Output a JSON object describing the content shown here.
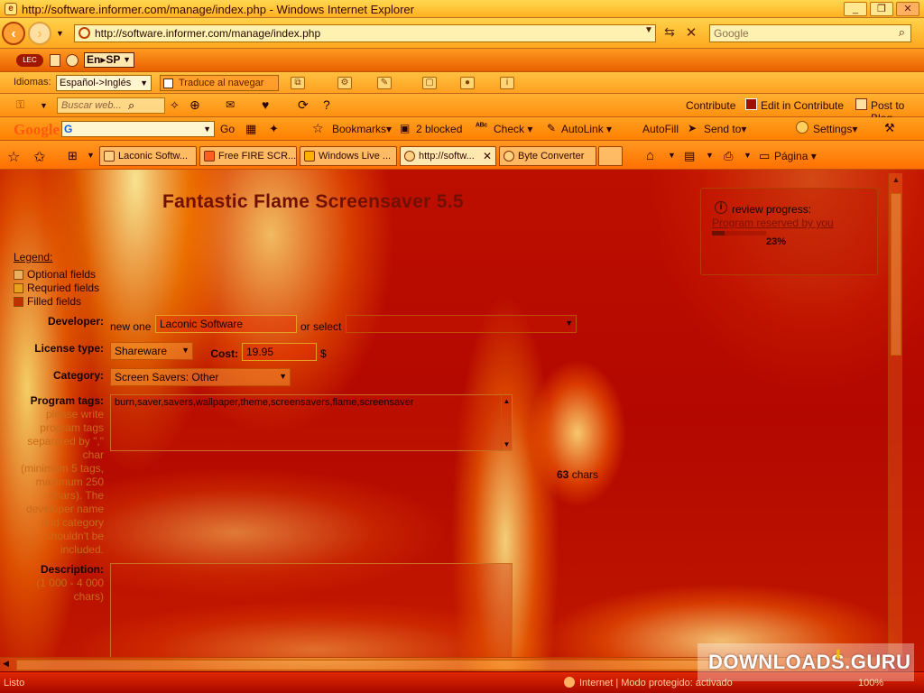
{
  "window": {
    "title": "http://software.informer.com/manage/index.php - Windows Internet Explorer",
    "minimize": "_",
    "restore": "❐",
    "close": "✕"
  },
  "address": {
    "url": "http://software.informer.com/manage/index.php",
    "search_placeholder": "Google"
  },
  "lec_bar": {
    "lec_label": "LEC",
    "language_switch": "En▸SP"
  },
  "lang_bar": {
    "idiomas_label": "Idiomas:",
    "language_value": "Español->Inglés",
    "translate_label": "Traduce al navegar"
  },
  "google_bar1": {
    "search_placeholder": "Buscar web...",
    "contribute": "Contribute",
    "edit_contribute": "Edit in Contribute",
    "post_blog": "Post to Blog"
  },
  "google_bar2": {
    "logo": "Google",
    "go": "Go",
    "bookmarks": "Bookmarks▾",
    "blocked": "2 blocked",
    "check": "Check ▾",
    "autolink": "AutoLink ▾",
    "autofill": "AutoFill",
    "send_to": "Send to▾",
    "settings": "Settings▾"
  },
  "tabs": [
    {
      "label": "Laconic Softw..."
    },
    {
      "label": "Free FIRE SCR..."
    },
    {
      "label": "Windows Live ..."
    },
    {
      "label": "http://softw..."
    },
    {
      "label": "Byte Converter"
    }
  ],
  "tab_tools": {
    "pagina": "Página ▾"
  },
  "page": {
    "title": "Fantastic Flame Screensaver 5.5",
    "legend_title": "Legend:",
    "legend": [
      {
        "label": "Optional fields",
        "color": "#e8b060"
      },
      {
        "label": "Requried fields",
        "color": "#e8a020"
      },
      {
        "label": "Filled fields",
        "color": "#c03000"
      }
    ],
    "developer": {
      "label": "Developer:",
      "new_one": "new one",
      "value": "Laconic Software",
      "or_select": "or select"
    },
    "license": {
      "label": "License type:",
      "value": "Shareware",
      "cost_label": "Cost:",
      "cost_value": "19.95",
      "currency": "$"
    },
    "category": {
      "label": "Category:",
      "value": "Screen Savers: Other"
    },
    "tags": {
      "label": "Program tags:",
      "help": [
        "please write",
        "program tags",
        "separated by \",\"",
        "char",
        "(minimum 5 tags,",
        "maximum 250",
        "chars). The",
        "developer name",
        "and category",
        "shouldn't be",
        "included."
      ],
      "value": "burn,saver,savers,wallpaper,theme,screensavers,flame,screensaver",
      "chars_count": "63",
      "chars_label": "chars"
    },
    "description": {
      "label": "Description:",
      "help": [
        "(1 000 - 4 000",
        "chars)"
      ]
    },
    "review": {
      "title": "review progress:",
      "status": "Program reserved by you",
      "progress": 0.23,
      "percent_text": "23%"
    }
  },
  "statusbar": {
    "left": "Listo",
    "zone": "Internet | Modo protegido: activado",
    "zoom": "100%"
  },
  "watermark": {
    "text": "DOWNLOADS",
    "suffix": ".GURU"
  }
}
